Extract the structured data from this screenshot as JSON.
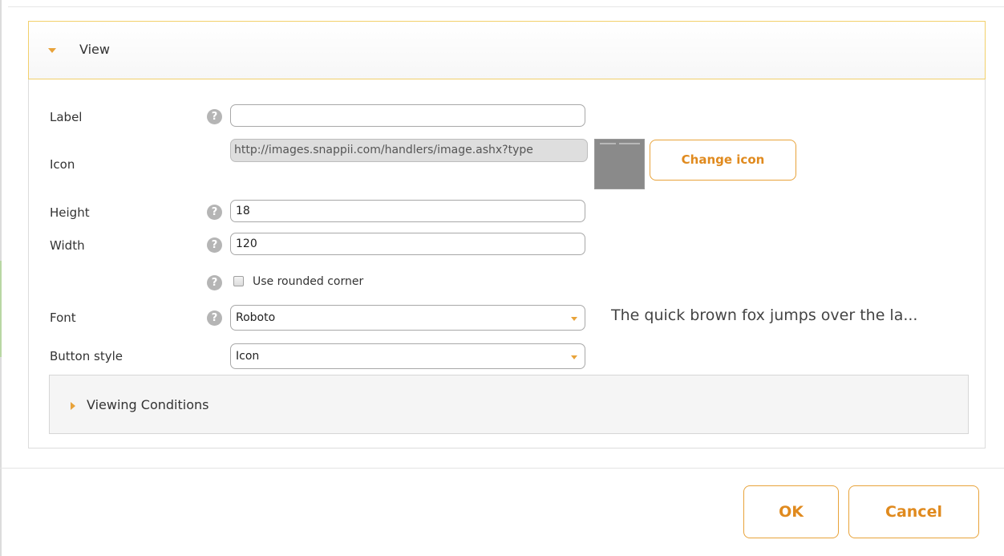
{
  "view_section": {
    "title": "View",
    "expanded": true
  },
  "form": {
    "label": {
      "label": "Label",
      "value": ""
    },
    "icon": {
      "label": "Icon",
      "url": "http://images.snappii.com/handlers/image.ashx?type",
      "change_button": "Change icon"
    },
    "height": {
      "label": "Height",
      "value": "18"
    },
    "width": {
      "label": "Width",
      "value": "120"
    },
    "rounded_corner": {
      "label": "Use rounded corner",
      "checked": false
    },
    "font": {
      "label": "Font",
      "selected": "Roboto",
      "preview": "The quick brown fox jumps over the la..."
    },
    "button_style": {
      "label": "Button style",
      "selected": "Icon"
    }
  },
  "help_glyph": "?",
  "viewing_conditions": {
    "title": "Viewing Conditions",
    "expanded": false
  },
  "footer": {
    "ok_label": "OK",
    "cancel_label": "Cancel"
  },
  "colors": {
    "accent": "#e8a33a",
    "header_border": "#f2d06b",
    "help_icon": "#b5b5b5"
  },
  "icons": {
    "view_toggle": "triangle-down-icon",
    "viewing_conditions_toggle": "triangle-right-icon",
    "help": "question-circle-icon",
    "select_caret": "caret-down-icon"
  }
}
